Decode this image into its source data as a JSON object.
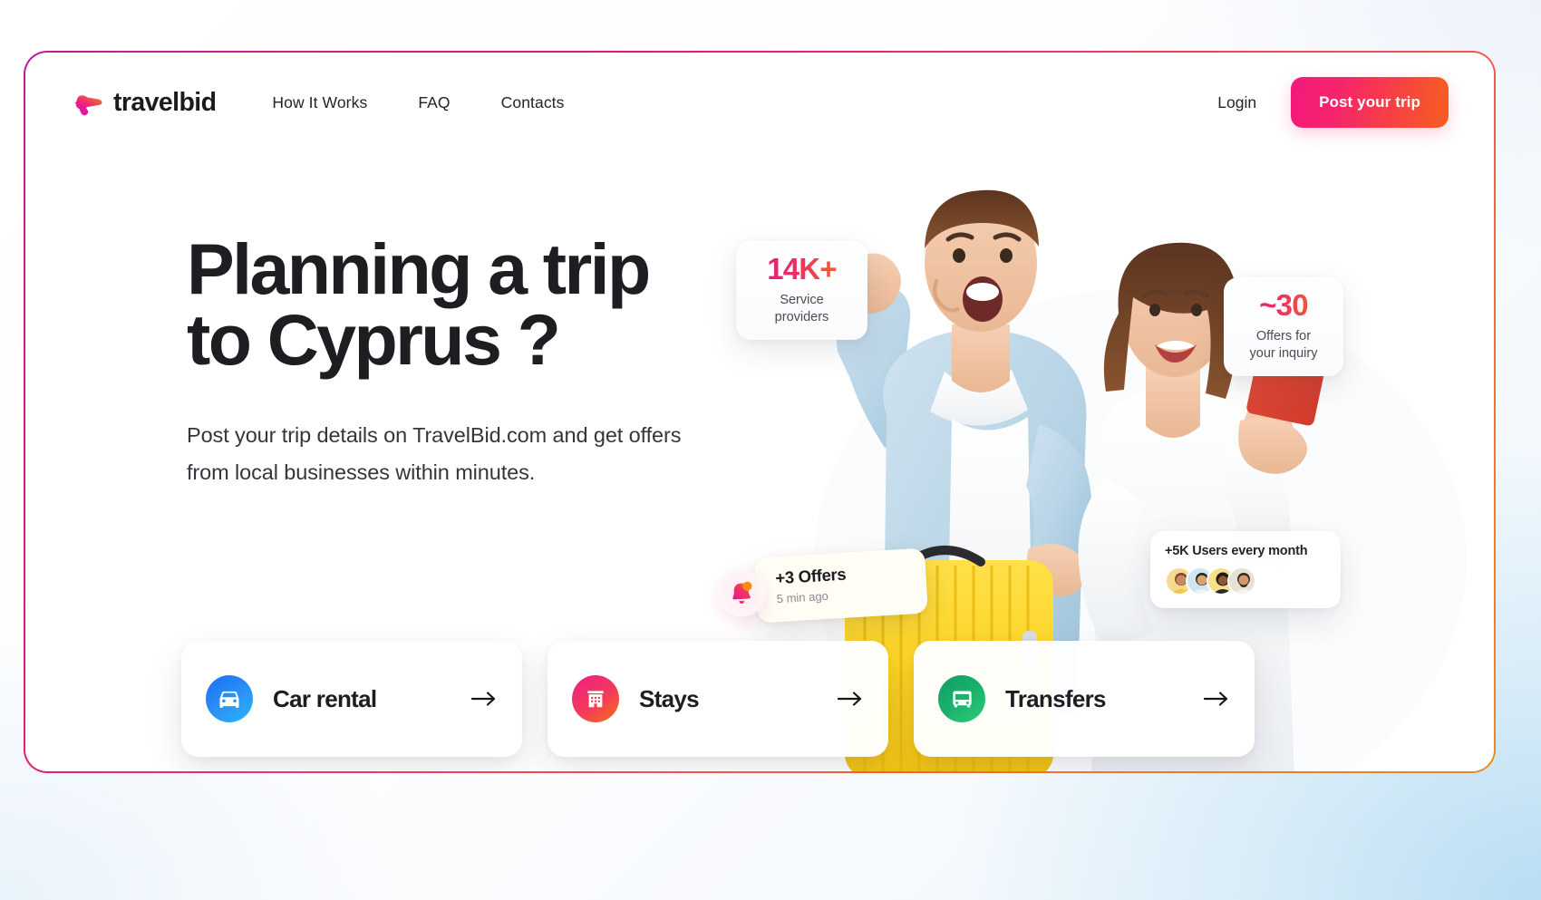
{
  "header": {
    "brand_name": "travelbid",
    "brand_icon": "plane-logo-icon",
    "nav": [
      {
        "label": "How It Works",
        "name": "how-it-works"
      },
      {
        "label": "FAQ",
        "name": "faq"
      },
      {
        "label": "Contacts",
        "name": "contacts"
      }
    ],
    "login_label": "Login",
    "cta_label": "Post your trip"
  },
  "hero": {
    "title": "Planning a trip\nto Cyprus ?",
    "subtitle": "Post your trip details on TravelBid.com and get offers from local businesses within minutes."
  },
  "stats": {
    "providers": {
      "value": "14K+",
      "label": "Service providers"
    },
    "offers": {
      "value": "~30",
      "label": "Offers for\nyour inquiry"
    }
  },
  "notification": {
    "icon": "bell-icon",
    "title": "+3 Offers",
    "time": "5 min ago"
  },
  "users_badge": {
    "title": "+5K Users every month",
    "avatar_count": 4
  },
  "services": [
    {
      "label": "Car rental",
      "icon": "car-icon",
      "arrow": "arrow-right-icon",
      "accent": "#2b93f5"
    },
    {
      "label": "Stays",
      "icon": "building-icon",
      "arrow": "arrow-right-icon",
      "accent": "#f33a5c"
    },
    {
      "label": "Transfers",
      "icon": "bus-icon",
      "arrow": "arrow-right-icon",
      "accent": "#1cb36d"
    }
  ],
  "theme": {
    "frame_border_start": "#c2189e",
    "frame_border_end": "#e98a22",
    "cta_gradient_start": "#f4197c",
    "cta_gradient_end": "#f55f1f",
    "text_dark": "#1e1e22",
    "background_tint": "#d8ecf8"
  }
}
